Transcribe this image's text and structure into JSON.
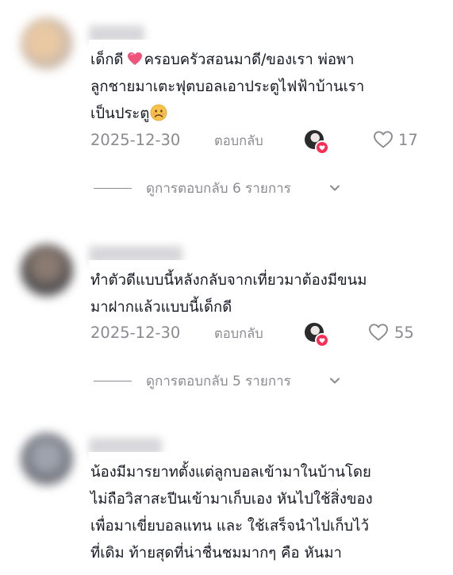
{
  "comments": [
    {
      "line1_pre": "เด็กดี",
      "line1_post": "ครอบครัวสอนมาดี/ของเรา พ่อพา",
      "line2": "ลูกชายมาเตะฟุตบอลเอาประตูไฟฟ้าบ้านเรา",
      "line3": "เป็นประตู",
      "emoji_1": "heart-emoji",
      "emoji_2": "frowning-face-emoji",
      "date": "2025-12-30",
      "reply_label": "ตอบกลับ",
      "likes": "17",
      "view_replies": "ดูการตอบกลับ 6 รายการ"
    },
    {
      "line1": "ทำตัวดีแบบนี้หลังกลับจากเที่ยวมาต้องมีขนม",
      "line2": "มาฝากแล้วแบบนี้เด็กดี",
      "date": "2025-12-30",
      "reply_label": "ตอบกลับ",
      "likes": "55",
      "view_replies": "ดูการตอบกลับ 5 รายการ"
    },
    {
      "line1": "น้องมีมารยาทตั้งแต่ลูกบอลเข้ามาในบ้านโดย",
      "line2": "ไม่ถือวิสาสะปีนเข้ามาเก็บเอง หันไปใช้สิ่งของ",
      "line3": "เพื่อมาเขี่ยบอลแทน และ ใช้เสร็จนำไปเก็บไว้",
      "line4": "ที่เดิม ท้ายสุดที่น่าชื่นชมมากๆ คือ หันมา"
    }
  ],
  "colors": {
    "text_primary": "#161823",
    "text_secondary": "#8a8b91",
    "accent_red": "#fe2c55"
  }
}
